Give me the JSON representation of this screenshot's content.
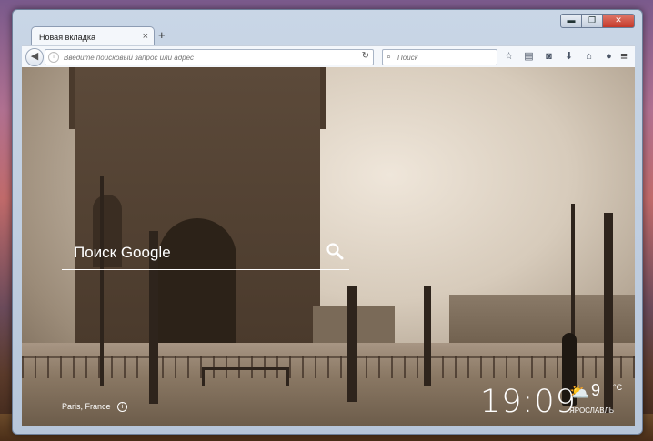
{
  "window": {
    "controls": {
      "minimize": "▬",
      "maximize": "❐",
      "close": "✕"
    }
  },
  "tab": {
    "title": "Новая вкладка",
    "close_label": "×",
    "new_tab_label": "+"
  },
  "toolbar": {
    "back_icon": "arrow-left",
    "url_placeholder": "Введите поисковый запрос или адрес",
    "reload_label": "↻",
    "search_placeholder": "Поиск",
    "icons": [
      "star-icon",
      "clipboard-icon",
      "pocket-icon",
      "download-icon",
      "home-icon",
      "chat-icon"
    ],
    "menu_label": "≡"
  },
  "newtab": {
    "search_placeholder": "Поиск Google",
    "location": "Paris, France",
    "clock": "19:09",
    "weather": {
      "temp": "9",
      "unit": "°C",
      "city": "ЯРОСЛАВЛЬ",
      "icon": "partly-cloudy-icon"
    }
  }
}
